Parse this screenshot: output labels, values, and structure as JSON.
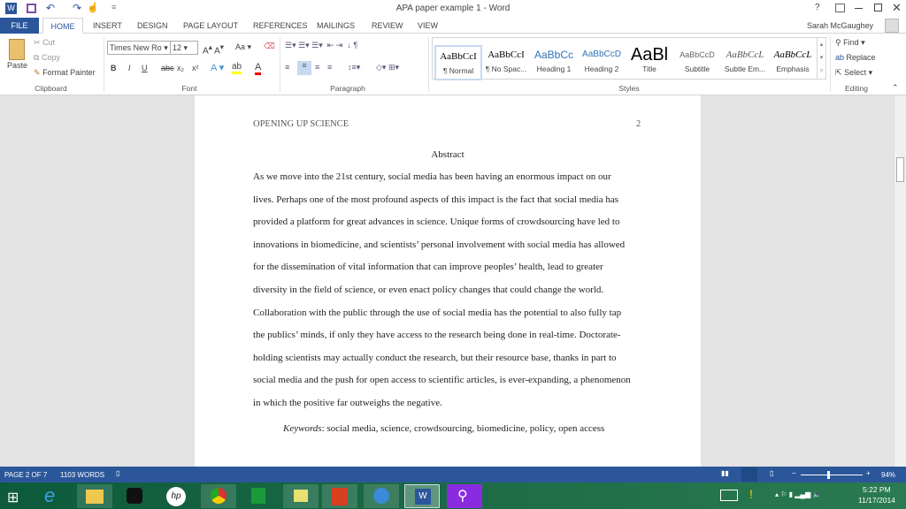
{
  "title": "APA paper example 1 - Word",
  "quick_access": [
    "save-icon",
    "undo-icon",
    "redo-icon",
    "touch-mode-icon",
    "customize-icon"
  ],
  "window_controls": {
    "help": "?"
  },
  "user": "Sarah McGaughey",
  "tabs": [
    "FILE",
    "HOME",
    "INSERT",
    "DESIGN",
    "PAGE LAYOUT",
    "REFERENCES",
    "MAILINGS",
    "REVIEW",
    "VIEW"
  ],
  "clipboard": {
    "paste": "Paste",
    "cut": "Cut",
    "copy": "Copy",
    "format_painter": "Format Painter",
    "label": "Clipboard"
  },
  "font": {
    "name": "Times New Ro",
    "size": "12",
    "case": "Aa",
    "bold": "B",
    "italic": "I",
    "underline": "U",
    "strike": "abc",
    "sub": "x₂",
    "sup": "x²",
    "label": "Font"
  },
  "paragraph": {
    "label": "Paragraph",
    "pilcrow": "¶"
  },
  "styles": {
    "label": "Styles",
    "items": [
      {
        "preview": "AaBbCcI",
        "name": "¶ Normal"
      },
      {
        "preview": "AaBbCcI",
        "name": "¶ No Spac..."
      },
      {
        "preview": "AaBbCc",
        "name": "Heading 1"
      },
      {
        "preview": "AaBbCcD",
        "name": "Heading 2"
      },
      {
        "preview": "AaBl",
        "name": "Title"
      },
      {
        "preview": "AaBbCcD",
        "name": "Subtitle"
      },
      {
        "preview": "AaBbCcL",
        "name": "Subtle Em..."
      },
      {
        "preview": "AaBbCcL",
        "name": "Emphasis"
      }
    ]
  },
  "editing": {
    "find": "Find",
    "replace": "Replace",
    "select": "Select",
    "label": "Editing"
  },
  "document": {
    "running_head": "OPENING UP SCIENCE",
    "page_number": "2",
    "heading": "Abstract",
    "lines": [
      "As we move into the 21st century, social media has been having an enormous impact on our",
      "lives. Perhaps one of the most profound aspects of this impact is the fact that social media has",
      "provided a platform for great advances in science. Unique forms of crowdsourcing have led to",
      "innovations in biomedicine, and scientists’ personal involvement with social media has allowed",
      "for the dissemination of vital information that can improve peoples’ health, lead to greater",
      "diversity in the field of science, or even enact policy changes that could change the world.",
      "Collaboration with the public through the use of social media has the potential to also fully tap",
      "the publics’ minds, if only they have access to the research being done in real-time. Doctorate-",
      "holding scientists may actually conduct the research, but their resource base, thanks in part to",
      "social media and the push for open access to scientific articles, is ever-expanding, a phenomenon",
      "in which the positive far outweighs the negative."
    ],
    "keywords_label": "Keywords",
    "keywords": ":  social media, science, crowdsourcing, biomedicine, policy, open access"
  },
  "status": {
    "page": "PAGE 2 OF 7",
    "words": "1103 WORDS",
    "zoom": "94%"
  },
  "clock": {
    "time": "5:22 PM",
    "date": "11/17/2014"
  },
  "colors": {
    "word_blue": "#2b579a",
    "taskbar": "#1a6643"
  }
}
